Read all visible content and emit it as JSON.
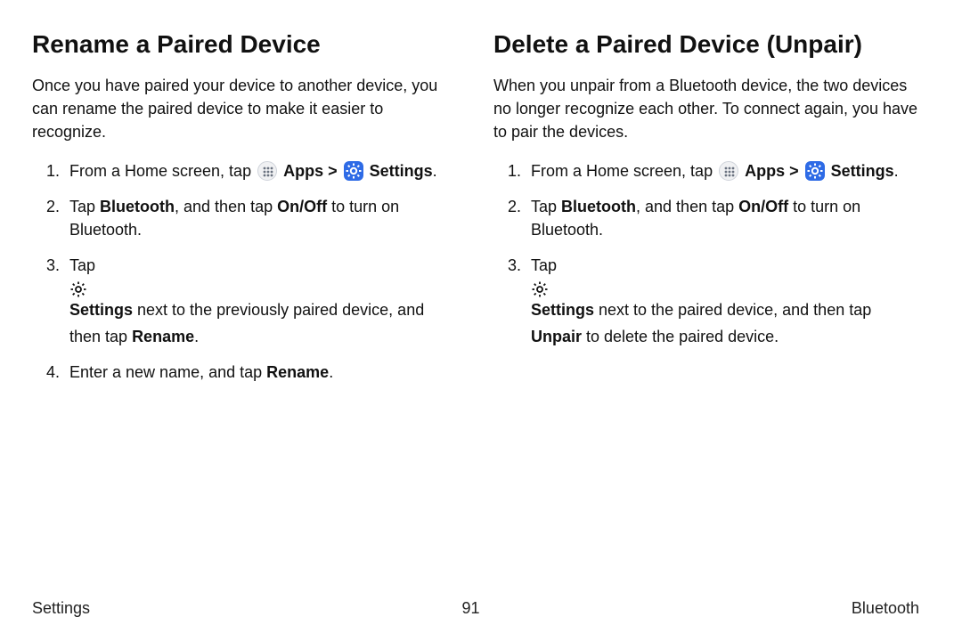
{
  "left": {
    "heading": "Rename a Paired Device",
    "intro": "Once you have paired your device to another device, you can rename the paired device to make it easier to recognize.",
    "steps": {
      "s1_pre": "From a Home screen, tap ",
      "s1_apps": "Apps",
      "s1_sep": " > ",
      "s1_settings": "Settings",
      "s1_post": ".",
      "s2_a": "Tap ",
      "s2_b": "Bluetooth",
      "s2_c": ", and then tap ",
      "s2_d": "On/Off",
      "s2_e": " to turn on Bluetooth.",
      "s3_a": "Tap ",
      "s3_b": "Settings",
      "s3_c": " next to the previously paired device, and then tap ",
      "s3_d": "Rename",
      "s3_e": ".",
      "s4_a": "Enter a new name, and tap ",
      "s4_b": "Rename",
      "s4_c": "."
    }
  },
  "right": {
    "heading": "Delete a Paired Device (Unpair)",
    "intro": "When you unpair from a Bluetooth device, the two devices no longer recognize each other. To connect again, you have to pair the devices.",
    "steps": {
      "s1_pre": "From a Home screen, tap ",
      "s1_apps": "Apps",
      "s1_sep": " > ",
      "s1_settings": "Settings",
      "s1_post": ".",
      "s2_a": "Tap ",
      "s2_b": "Bluetooth",
      "s2_c": ", and then tap ",
      "s2_d": "On/Off",
      "s2_e": " to turn on Bluetooth.",
      "s3_a": "Tap ",
      "s3_b": "Settings",
      "s3_c": " next to the paired device, and then tap ",
      "s3_d": "Unpair",
      "s3_e": " to delete the paired device."
    }
  },
  "footer": {
    "left": "Settings",
    "center": "91",
    "right": "Bluetooth"
  }
}
